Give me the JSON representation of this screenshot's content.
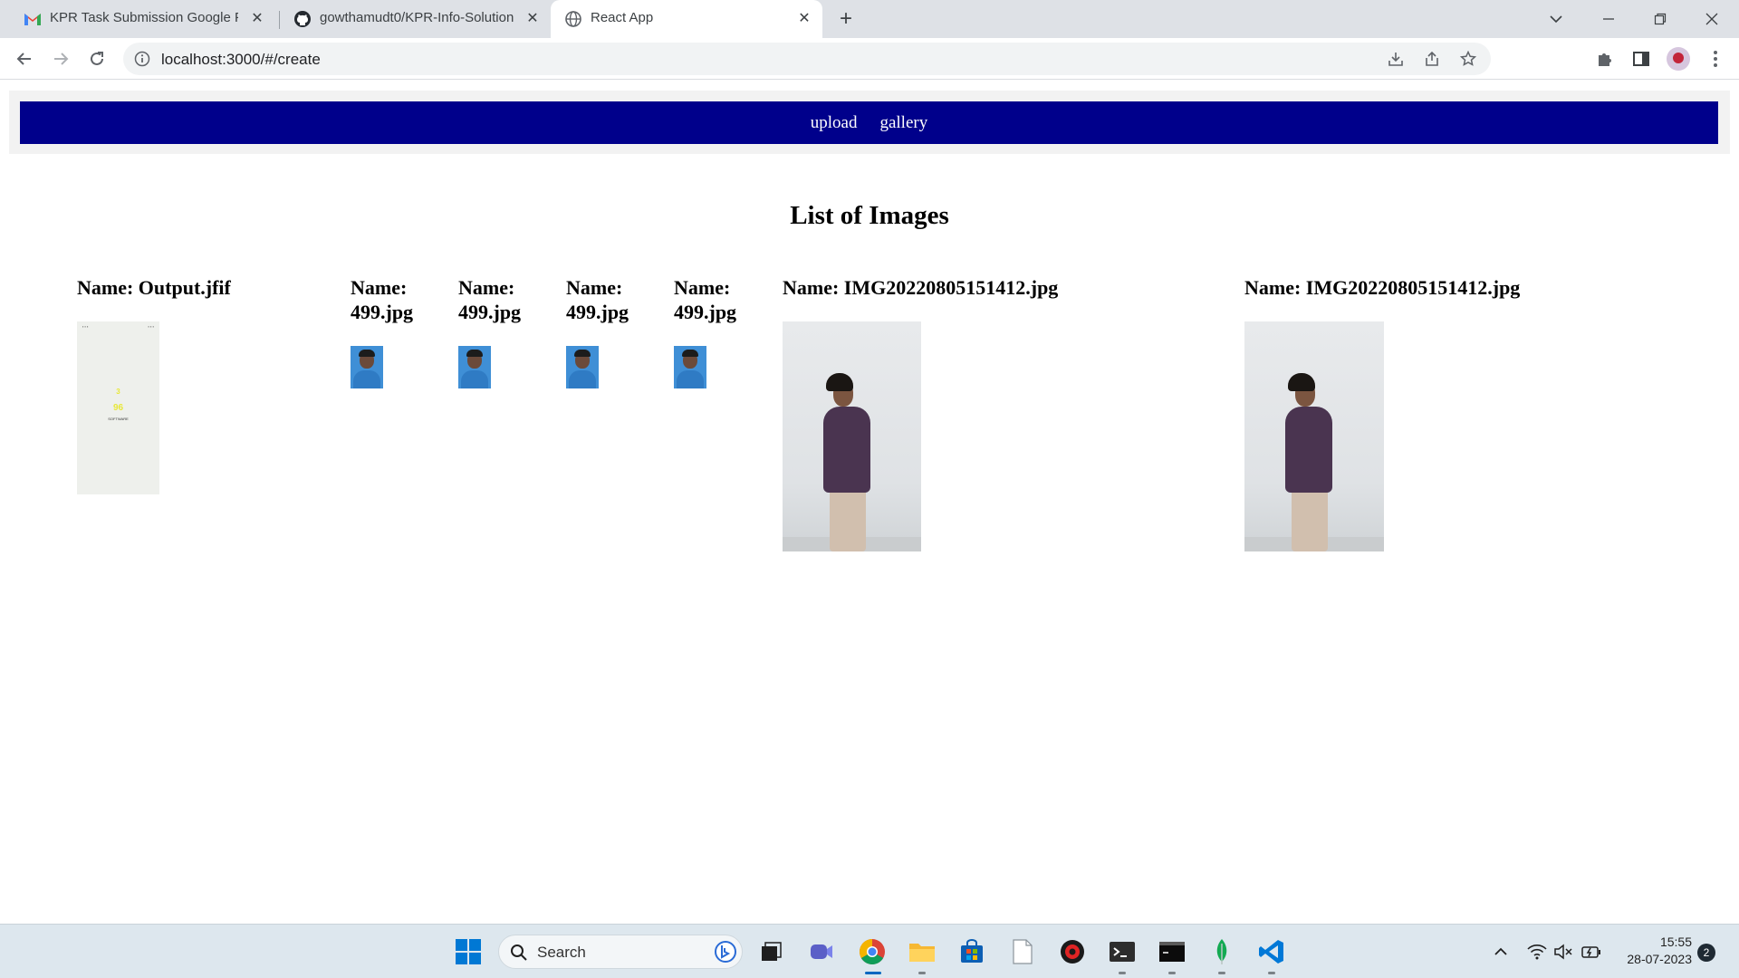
{
  "browser": {
    "tabs": [
      {
        "title": "KPR Task Submission Google Form",
        "icon": "gmail-icon"
      },
      {
        "title": "gowthamudt0/KPR-Info-Solution",
        "icon": "github-icon"
      },
      {
        "title": "React App",
        "icon": "globe-icon",
        "active": true
      }
    ],
    "close_glyph": "✕",
    "new_tab_glyph": "+",
    "url": "localhost:3000/#/create"
  },
  "page": {
    "nav": [
      {
        "label": "upload"
      },
      {
        "label": "gallery"
      }
    ],
    "title": "List of Images",
    "images": [
      {
        "name": "Name: Output.jfif",
        "image": "phone-screenshot"
      },
      {
        "name": "Name: 499.jpg",
        "image": "passport-photo"
      },
      {
        "name": "Name: 499.jpg",
        "image": "passport-photo"
      },
      {
        "name": "Name: 499.jpg",
        "image": "passport-photo"
      },
      {
        "name": "Name: 499.jpg",
        "image": "passport-photo"
      },
      {
        "name": "Name: IMG20220805151412.jpg",
        "image": "person-photo"
      },
      {
        "name": "Name: IMG20220805151412.jpg",
        "image": "person-photo"
      }
    ],
    "output_thumb": {
      "line1": "3",
      "line2": "96",
      "line3": "SOFTWARE"
    }
  },
  "taskbar": {
    "search_label": "Search",
    "time": "15:55",
    "date": "28-07-2023",
    "notifications": "2"
  },
  "colors": {
    "nav_bg": "#00008b",
    "tab_strip": "#dee1e6",
    "taskbar": "#dde7ee",
    "accent": "#0067c0"
  }
}
